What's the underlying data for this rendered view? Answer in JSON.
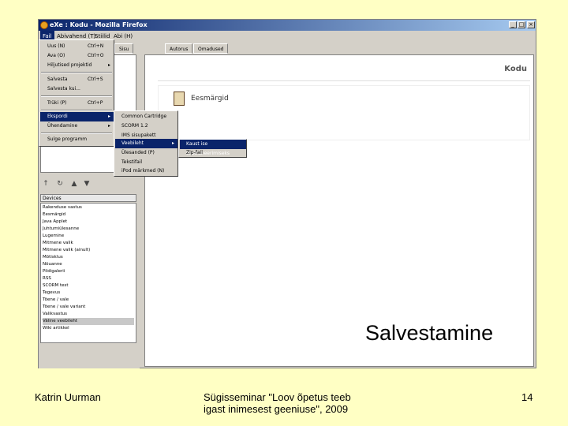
{
  "window": {
    "title": "eXe : Kodu - Mozilla Firefox",
    "controls": [
      "_",
      "□",
      "×"
    ]
  },
  "menubar": [
    "Fail",
    "Abivahend (T)",
    "Stiilid",
    "Abi (H)"
  ],
  "file_menu": {
    "items": [
      {
        "label": "Uus (N)",
        "shortcut": "Ctrl+N"
      },
      {
        "label": "Ava (O)",
        "shortcut": "Ctrl+O"
      },
      {
        "label": "Hiljutised projektid",
        "shortcut": "",
        "submenu": true
      },
      {
        "label": "Salvesta",
        "shortcut": "Ctrl+S"
      },
      {
        "label": "Salvesta kui...",
        "shortcut": ""
      },
      {
        "label": "Trüki (P)",
        "shortcut": "Ctrl+P"
      },
      {
        "label": "Ekspordi",
        "shortcut": "",
        "submenu": true
      },
      {
        "label": "Ühendamine",
        "shortcut": "",
        "submenu": true
      },
      {
        "label": "Sulge programm",
        "shortcut": ""
      }
    ]
  },
  "export_menu": {
    "items": [
      "Common Cartridge",
      "SCORM 1.2",
      "IMS sisupakett",
      "Veebileht",
      "Ülesanded (P)",
      "Tekstifail",
      "iPod märkmed (N)"
    ]
  },
  "web_menu": {
    "items": [
      "Kaust ise ekstraheerimiseks",
      "Zip-fail"
    ]
  },
  "left_panel": {
    "nav_tab": "Sisu",
    "tool_icons": [
      "↑",
      "↻",
      "▲",
      "▼"
    ],
    "devices_label": "Devices",
    "devices": [
      "Rakenduse vastus",
      "Eesmärgid",
      "Java Applet",
      "Juhtumiülesanne",
      "Lugemine",
      "Mitmene valik",
      "Mitmene valik (ainult)",
      "Mõtisklus",
      "Nõuanne",
      "Pildigalerii",
      "RSS",
      "SCORM test",
      "Tegevus",
      "Tõene / vale",
      "Tõene / vale variant",
      "Valikvastus",
      "Väline veebileht",
      "Wiki artikkel"
    ],
    "selected_device": "Väline veebileht"
  },
  "tabs": [
    "Autorus",
    "Omadused"
  ],
  "content": {
    "page_title": "Kodu",
    "idevice_title": "Eesmärgid"
  },
  "slide": {
    "caption": "Salvestamine",
    "author": "Katrin Uurman",
    "event_line1": "Sügisseminar \"Loov õpetus teeb",
    "event_line2": "igast inimesest geeniuse\", 2009",
    "page_number": "14"
  }
}
